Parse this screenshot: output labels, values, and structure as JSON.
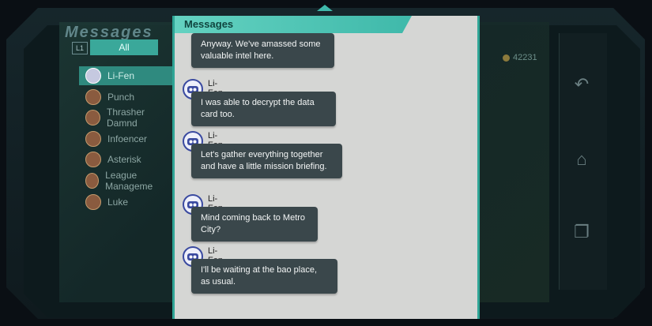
{
  "background": {
    "title": "Messages",
    "filter_button_hint": "L1",
    "filter_label": "All",
    "contacts": [
      "Li-Fen",
      "Punch",
      "Thrasher Damnd",
      "Infoencer",
      "Asterisk",
      "League Manageme",
      "Luke"
    ],
    "coins": "42231"
  },
  "dialog": {
    "title": "Messages",
    "messages": [
      {
        "sender": "",
        "text": "Anyway. We've amassed some valuable intel here."
      },
      {
        "sender": "Li-Fen",
        "text": "I was able to decrypt the data card too."
      },
      {
        "sender": "Li-Fen",
        "text": "Let's gather everything together and have a little mission briefing."
      },
      {
        "sender": "Li-Fen",
        "text": "Mind coming back to Metro City?"
      },
      {
        "sender": "Li-Fen",
        "text": "I'll be waiting at the bao place, as usual."
      }
    ]
  },
  "colors": {
    "accent": "#3fb9aa",
    "bubble": "#3a474b",
    "dialog_bg": "#d5d6d4"
  },
  "icons": [
    "back-arrow-icon",
    "home-icon",
    "window-icon",
    "coin-icon",
    "contact-avatar-icon"
  ]
}
